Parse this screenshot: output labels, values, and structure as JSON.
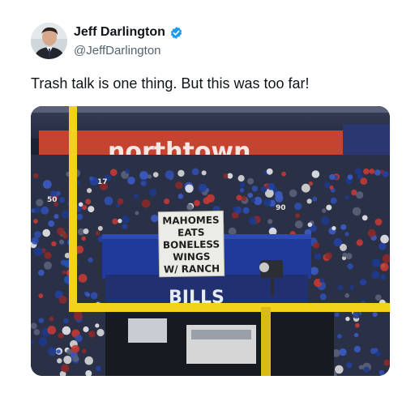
{
  "author": {
    "display_name": "Jeff Darlington",
    "handle": "@JeffDarlington",
    "verified_icon": "verified-badge-icon",
    "badge_color": "#1d9bf0"
  },
  "tweet": {
    "text": "Trash talk is one thing. But this was too far!"
  },
  "media": {
    "description_icon": "stadium-photo",
    "sign_lines": [
      "MAHOMES",
      "EATS",
      "BONELESS",
      "WINGS",
      "W/ RANCH"
    ],
    "sponsor_text": "northtown",
    "stadium_banner_text": "BILLS",
    "jersey_numbers": [
      "50",
      "17",
      "90"
    ]
  }
}
